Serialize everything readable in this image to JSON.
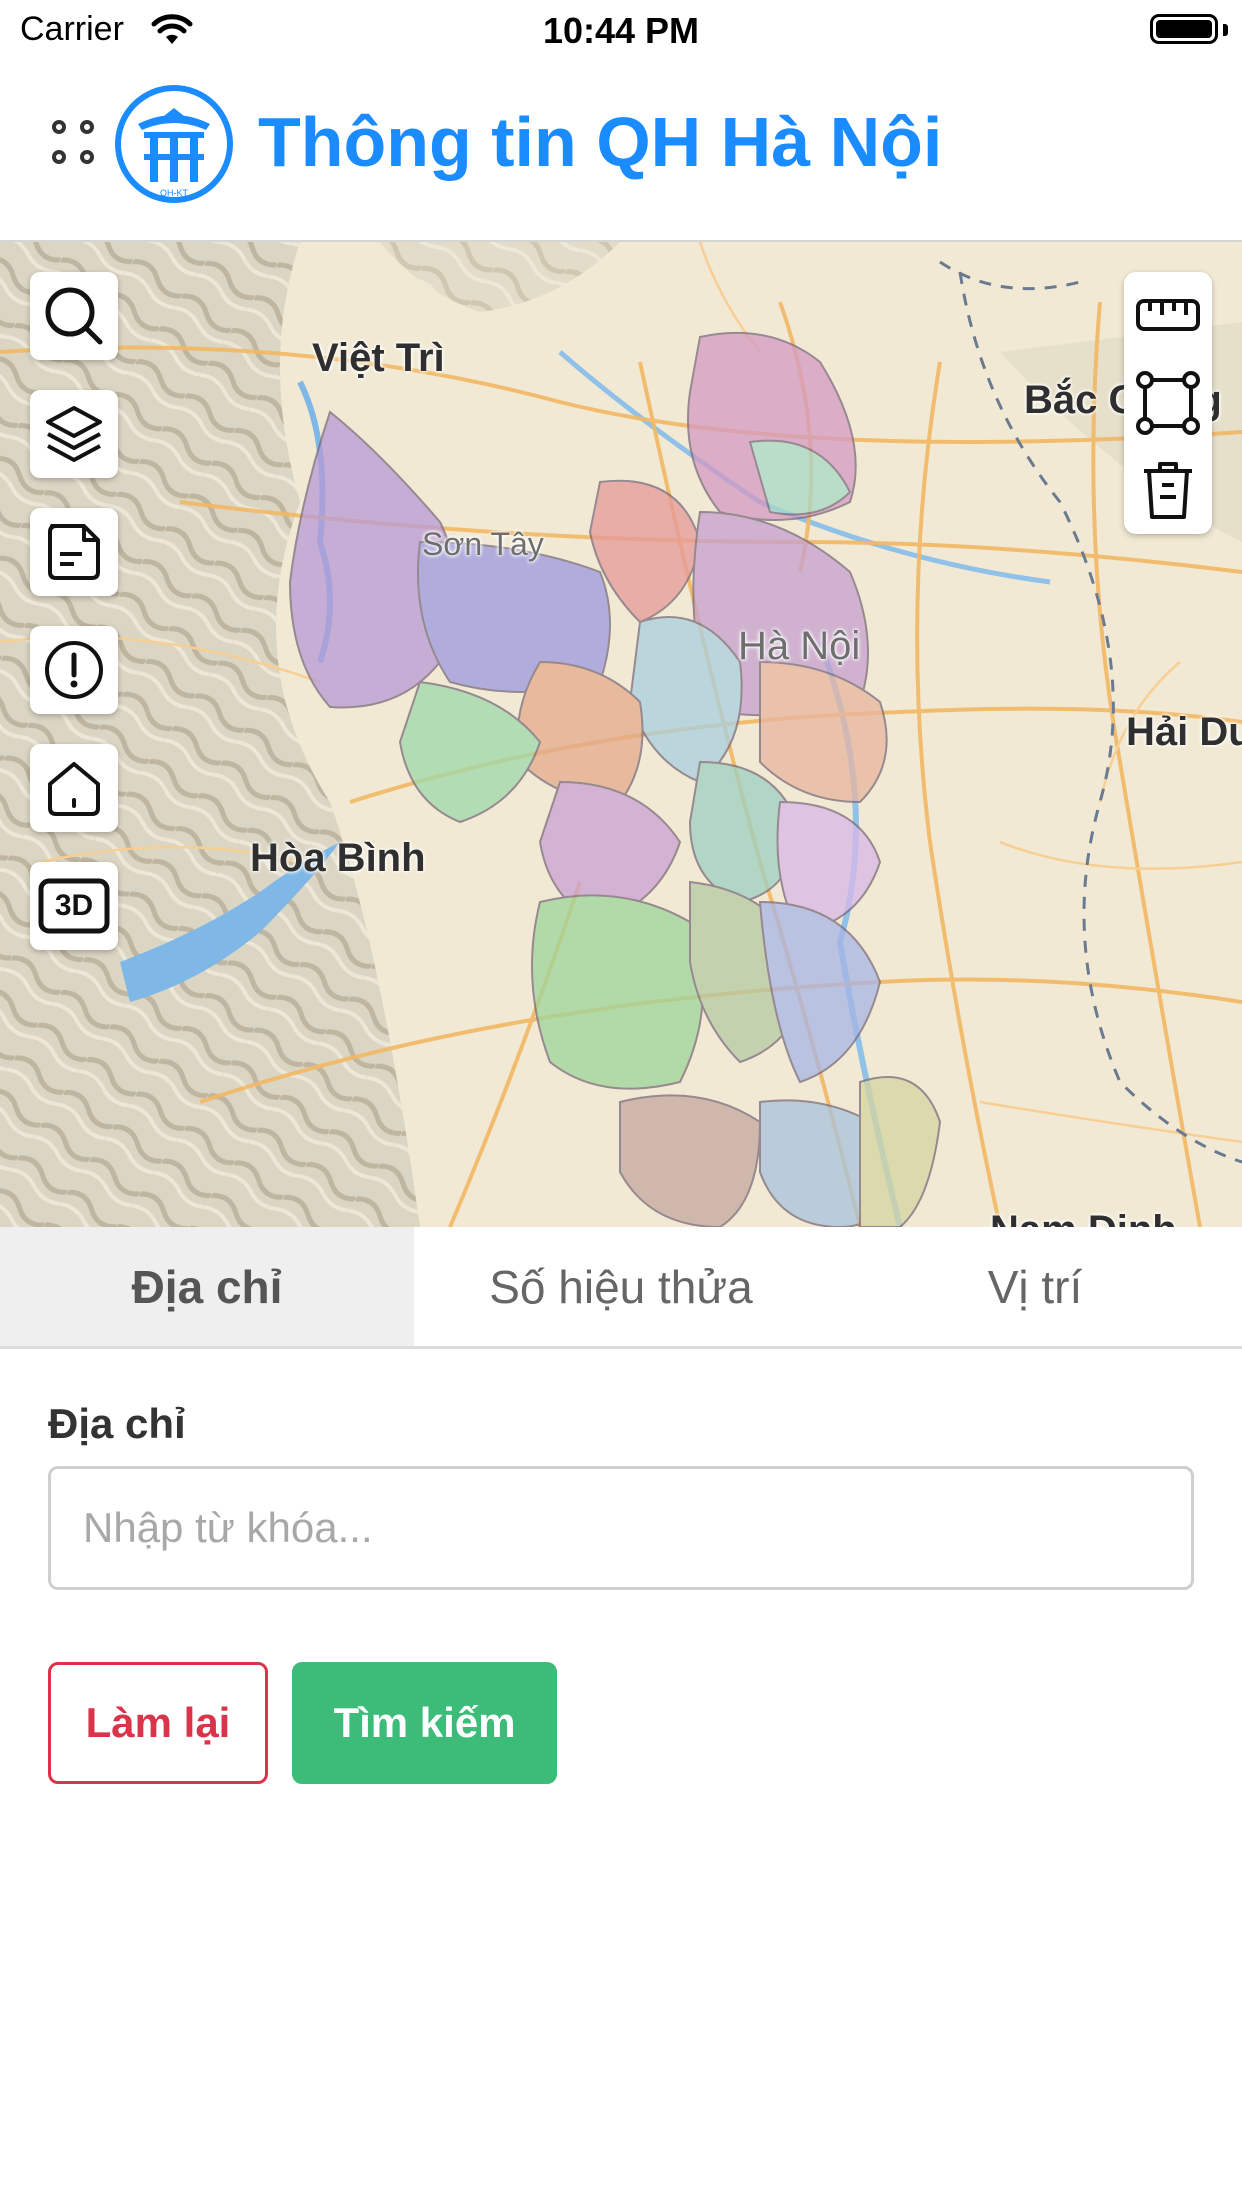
{
  "status_bar": {
    "carrier": "Carrier",
    "time": "10:44 PM"
  },
  "header": {
    "title": "Thông tin QH Hà Nội",
    "logo_text": "QH-KT"
  },
  "map": {
    "labels": {
      "viet_tri": "Việt Trì",
      "bac_giang": "Bắc Giang",
      "son_tay": "Sơn Tây",
      "ha_noi": "Hà Nội",
      "hai_duong": "Hải Dư",
      "hoa_binh": "Hòa Bình",
      "nam_dinh": "Nam Định"
    },
    "left_tools": [
      "search-icon",
      "layers-icon",
      "note-icon",
      "alert-icon",
      "home-icon",
      "3d-icon"
    ],
    "three_d_label": "3D",
    "right_tools": [
      "ruler-icon",
      "polygon-select-icon",
      "trash-icon"
    ]
  },
  "tabs": [
    {
      "label": "Địa chỉ",
      "active": true
    },
    {
      "label": "Số hiệu thửa",
      "active": false
    },
    {
      "label": "Vị trí",
      "active": false
    }
  ],
  "form": {
    "label": "Địa chỉ",
    "input_value": "",
    "input_placeholder": "Nhập từ khóa...",
    "reset_label": "Làm lại",
    "search_label": "Tìm kiếm"
  },
  "colors": {
    "accent_blue": "#1a8cff",
    "reset_red": "#d9344a",
    "search_green": "#3dbb79"
  }
}
